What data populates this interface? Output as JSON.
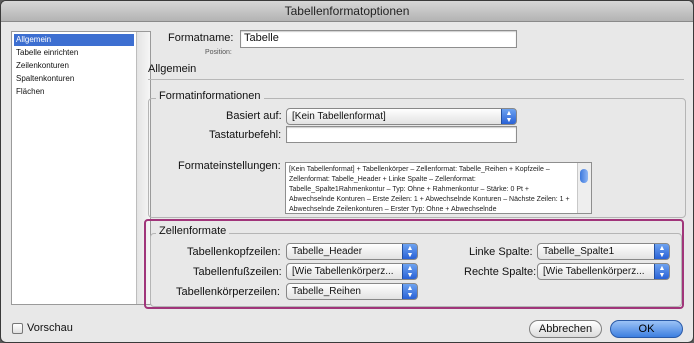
{
  "window": {
    "title": "Tabellenformatoptionen"
  },
  "sidebar": {
    "items": [
      {
        "label": "Allgemein",
        "selected": true
      },
      {
        "label": "Tabelle einrichten",
        "selected": false
      },
      {
        "label": "Zeilenkonturen",
        "selected": false
      },
      {
        "label": "Spaltenkonturen",
        "selected": false
      },
      {
        "label": "Flächen",
        "selected": false
      }
    ]
  },
  "format": {
    "name_label": "Formatname:",
    "name_value": "Tabelle",
    "position_label": "Position:",
    "section_title": "Allgemein"
  },
  "info": {
    "group_title": "Formatinformationen",
    "based_on_label": "Basiert auf:",
    "based_on_value": "[Kein Tabellenformat]",
    "shortcut_label": "Tastaturbefehl:",
    "shortcut_value": "",
    "settings_label": "Formateinstellungen:",
    "settings_text": "[Kein Tabellenformat] + Tabellenkörper – Zellenformat: Tabelle_Reihen + Kopfzeile – Zellenformat: Tabelle_Header + Linke Spalte – Zellenformat: Tabelle_Spalte1Rahmenkontur – Typ: Ohne + Rahmenkontur – Stärke: 0 Pt + Abwechselnde Konturen – Erste Zeilen: 1 + Abwechselnde Konturen – Nächste Zeilen: 1 + Abwechselnde Zeilenkonturen – Erster Typ: Ohne + Abwechselnde"
  },
  "cells": {
    "group_title": "Zellenformate",
    "header_label": "Tabellenkopfzeilen:",
    "header_value": "Tabelle_Header",
    "footer_label": "Tabellenfußzeilen:",
    "footer_value": "[Wie Tabellenkörperz...",
    "body_label": "Tabellenkörperzeilen:",
    "body_value": "Tabelle_Reihen",
    "left_label": "Linke Spalte:",
    "left_value": "Tabelle_Spalte1",
    "right_label": "Rechte Spalte:",
    "right_value": "[Wie Tabellenkörperz..."
  },
  "footer": {
    "preview_label": "Vorschau",
    "cancel_label": "Abbrechen",
    "ok_label": "OK"
  },
  "colors": {
    "accent": "#3d7fe0",
    "highlight": "#a0357a",
    "selection": "#3d6fd1"
  }
}
